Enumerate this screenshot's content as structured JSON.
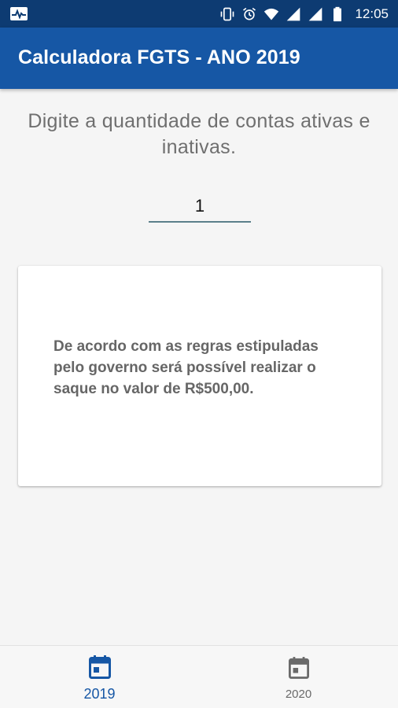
{
  "status_bar": {
    "time": "12:05",
    "icons": [
      "activity-notification-icon",
      "vibrate-icon",
      "alarm-icon",
      "wifi-icon",
      "signal-icon",
      "signal-icon",
      "battery-icon"
    ]
  },
  "app_bar": {
    "title": "Calculadora FGTS - ANO 2019"
  },
  "main": {
    "prompt": "Digite a quantidade de contas ativas e inativas.",
    "input_value": "1",
    "result_text": "De acordo com as regras estipuladas pelo governo será possível realizar o saque no valor de R$500,00."
  },
  "bottom_nav": {
    "items": [
      {
        "label": "2019",
        "icon": "calendar-icon",
        "selected": true
      },
      {
        "label": "2020",
        "icon": "calendar-icon",
        "selected": false
      }
    ]
  },
  "colors": {
    "status_bar": "#0d3b72",
    "app_bar": "#1657a5",
    "active_nav": "#1657a5",
    "inactive_nav": "#6a6a6a"
  }
}
